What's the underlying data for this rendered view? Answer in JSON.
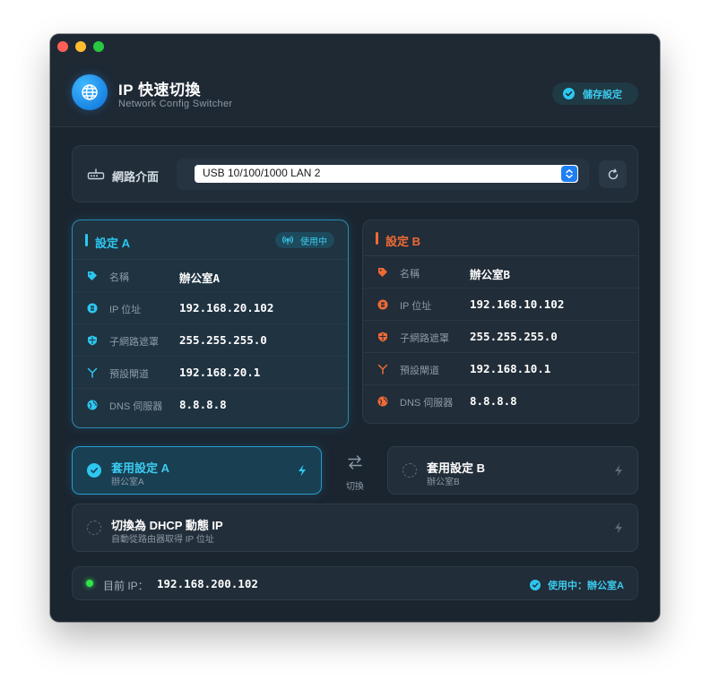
{
  "app": {
    "title": "IP 快速切換",
    "subtitle": "Network Config Switcher",
    "save_label": "儲存設定"
  },
  "interface": {
    "label": "網路介面",
    "selected": "USB 10/100/1000 LAN 2"
  },
  "config_a": {
    "title": "設定 A",
    "badge": "使用中",
    "rows": [
      {
        "label": "名稱",
        "value": "辦公室A",
        "icon": "tag-icon"
      },
      {
        "label": "IP 位址",
        "value": "192.168.20.102",
        "icon": "ip-icon"
      },
      {
        "label": "子網路遮罩",
        "value": "255.255.255.0",
        "icon": "shield-icon"
      },
      {
        "label": "預設閘道",
        "value": "192.168.20.1",
        "icon": "gateway-icon"
      },
      {
        "label": "DNS 伺服器",
        "value": "8.8.8.8",
        "icon": "globe-icon"
      }
    ]
  },
  "config_b": {
    "title": "設定 B",
    "rows": [
      {
        "label": "名稱",
        "value": "辦公室B",
        "icon": "tag-icon"
      },
      {
        "label": "IP 位址",
        "value": "192.168.10.102",
        "icon": "ip-icon"
      },
      {
        "label": "子網路遮罩",
        "value": "255.255.255.0",
        "icon": "shield-icon"
      },
      {
        "label": "預設閘道",
        "value": "192.168.10.1",
        "icon": "gateway-icon"
      },
      {
        "label": "DNS 伺服器",
        "value": "8.8.8.8",
        "icon": "globe-icon"
      }
    ]
  },
  "actions": {
    "apply_a": {
      "title": "套用設定 A",
      "subtitle": "辦公室A"
    },
    "apply_b": {
      "title": "套用設定 B",
      "subtitle": "辦公室B"
    },
    "swap_label": "切換",
    "dhcp": {
      "title": "切換為 DHCP 動態 IP",
      "subtitle": "自動從路由器取得 IP 位址"
    }
  },
  "status": {
    "label": "目前 IP：",
    "ip": "192.168.200.102",
    "in_use": "使用中：辦公室A"
  },
  "colors": {
    "accent_a": "#2cc7f0",
    "accent_b": "#f06a36",
    "status_ok": "#32e34c",
    "window_bg": "#1b2530"
  }
}
